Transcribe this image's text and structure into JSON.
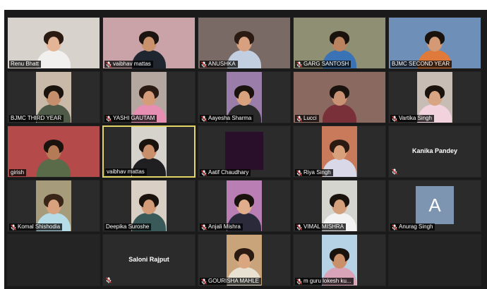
{
  "participants": [
    {
      "name": "Renu Bhatt",
      "muted": false,
      "type": "video",
      "bg": "#d8d2cc",
      "skin": "#e3b596",
      "shirt": "#f2f0ee",
      "hair": "#2a1a12"
    },
    {
      "name": "vaibhav mattas",
      "muted": true,
      "type": "video",
      "bg": "#c9a3a8",
      "skin": "#c9916c",
      "shirt": "#1f2630",
      "hair": "#1c1410"
    },
    {
      "name": "ANUSHKA",
      "muted": true,
      "type": "video",
      "bg": "#7a6a66",
      "skin": "#d7a07e",
      "shirt": "#c1cfe0",
      "hair": "#2a1a12"
    },
    {
      "name": "GARG SANTOSH",
      "muted": true,
      "type": "video",
      "bg": "#8f8f74",
      "skin": "#b8835e",
      "shirt": "#3a73b5",
      "hair": "#1a120c"
    },
    {
      "name": "BJMC SECOND YEAR",
      "muted": false,
      "type": "video",
      "bg": "#6d8fb8",
      "skin": "#d49a76",
      "shirt": "#e07a3a",
      "hair": "#1a120c"
    },
    {
      "name": "BJMC THIRD YEAR",
      "muted": false,
      "type": "video-center",
      "bg": "#c9b9a8",
      "skin": "#c58f6d",
      "shirt": "#4f5a48",
      "hair": "#1a120c"
    },
    {
      "name": "YASHI GAUTAM",
      "muted": true,
      "type": "video-center",
      "bg": "#b4a7a0",
      "skin": "#d59c7a",
      "shirt": "#e78fb3",
      "hair": "#2a1a12"
    },
    {
      "name": "Aayesha Sharma",
      "muted": true,
      "type": "video-center",
      "bg": "#9a7da8",
      "skin": "#d9a27f",
      "shirt": "#2a2a2a",
      "hair": "#1a120c"
    },
    {
      "name": "Lucci",
      "muted": true,
      "type": "video",
      "bg": "#8a6a60",
      "skin": "#c99273",
      "shirt": "#7a3038",
      "hair": "#1a120c"
    },
    {
      "name": "Vartika Singh",
      "muted": true,
      "type": "video-center",
      "bg": "#c7bdb5",
      "skin": "#d8a582",
      "shirt": "#f1d2dd",
      "hair": "#1a120c"
    },
    {
      "name": "girish",
      "muted": false,
      "type": "video",
      "bg": "#b44a4a",
      "skin": "#b57a56",
      "shirt": "#5a6b4a",
      "hair": "#1a120c"
    },
    {
      "name": "vaibhav mattas",
      "muted": false,
      "type": "video-center",
      "bg": "#d6d2cc",
      "skin": "#c98f6a",
      "shirt": "#1f1f22",
      "hair": "#1a120c",
      "active": true
    },
    {
      "name": "Aatif Chaudhary",
      "muted": true,
      "type": "dark"
    },
    {
      "name": "Riya Singh",
      "muted": true,
      "type": "video-center",
      "bg": "#c87a5a",
      "skin": "#d9a07c",
      "shirt": "#d8d8e8",
      "hair": "#2a1a12"
    },
    {
      "name": "Kanika Pandey",
      "muted": true,
      "type": "name-only"
    },
    {
      "name": "Komal Shishodia",
      "muted": true,
      "type": "video-center",
      "bg": "#a69c7c",
      "skin": "#d8a27e",
      "shirt": "#b6dce8",
      "hair": "#3a2618"
    },
    {
      "name": "Deepika Suroshe",
      "muted": false,
      "type": "video-center",
      "bg": "#d9cfc4",
      "skin": "#d39b78",
      "shirt": "#3a5a5a",
      "hair": "#1a120c"
    },
    {
      "name": "Anjali Mishra",
      "muted": true,
      "type": "video-center",
      "bg": "#b97fb4",
      "skin": "#e0ad8d",
      "shirt": "#2a2a3a",
      "hair": "#1a120c"
    },
    {
      "name": "VIMAL MISHRA",
      "muted": true,
      "type": "video-center",
      "bg": "#d5d5d0",
      "skin": "#d4a07c",
      "shirt": "#f3f3f3",
      "hair": "#1a120c"
    },
    {
      "name": "Anurag Singh",
      "muted": true,
      "type": "avatar",
      "initial": "A"
    },
    {
      "name": "",
      "muted": false,
      "type": "empty"
    },
    {
      "name": "Saloni Rajput",
      "muted": true,
      "type": "name-only"
    },
    {
      "name": "GOURISHA MAHLE",
      "muted": true,
      "type": "video-center",
      "bg": "#c9a47a",
      "skin": "#d9a680",
      "shirt": "#e8e0d0",
      "hair": "#2a1a12"
    },
    {
      "name": "m guru lokesh ku...",
      "muted": true,
      "type": "video-center",
      "bg": "#b6d3e6",
      "skin": "#c99069",
      "shirt": "#d9a3b8",
      "hair": "#1a120c"
    },
    {
      "name": "",
      "muted": false,
      "type": "empty"
    }
  ],
  "colors": {
    "window_bg": "#1a1a1a",
    "tile_bg": "#2b2b2b",
    "active_border": "#e3d46a",
    "muted_icon": "#e0383a",
    "avatar_bg": "#7d95b0"
  }
}
